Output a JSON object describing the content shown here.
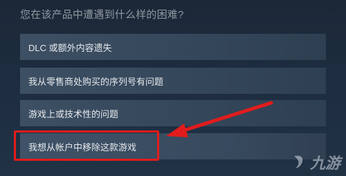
{
  "question": "您在该产品中遭遇到什么样的困难?",
  "options": [
    {
      "label": "DLC 或额外内容遗失"
    },
    {
      "label": "我从零售商处购买的序列号有问题"
    },
    {
      "label": "游戏上或技术性的问题"
    },
    {
      "label": "我想从帐户中移除这款游戏"
    }
  ],
  "watermark": {
    "text": "九游"
  },
  "colors": {
    "background": "#1b2838",
    "option_bg": "#3d4f63",
    "highlight": "#e21c1c",
    "question_text": "#8f98a0"
  }
}
